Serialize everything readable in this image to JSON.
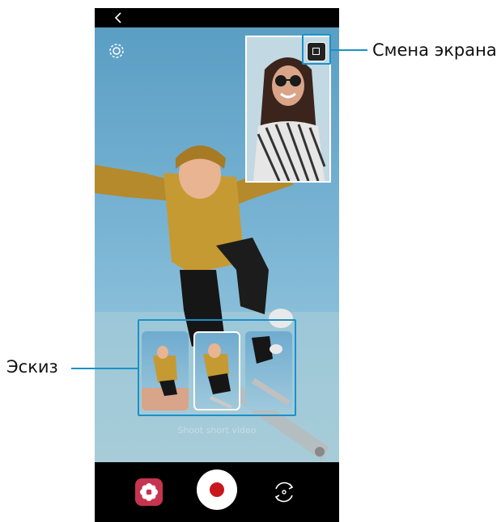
{
  "callouts": {
    "switch_screens": "Смена экрана",
    "thumbnail": "Эскиз"
  },
  "icons": {
    "back": "back-arrow-icon",
    "settings": "gear-icon",
    "switch": "switch-screen-icon",
    "fun": "filter-flower-icon",
    "shutter": "record-icon",
    "flip": "flip-camera-icon"
  },
  "viewfinder": {
    "caption": "Shoot short video"
  },
  "colors": {
    "accent_callout": "#1a91c9",
    "record_red": "#c8161d",
    "fun_button": "#c6344f"
  }
}
